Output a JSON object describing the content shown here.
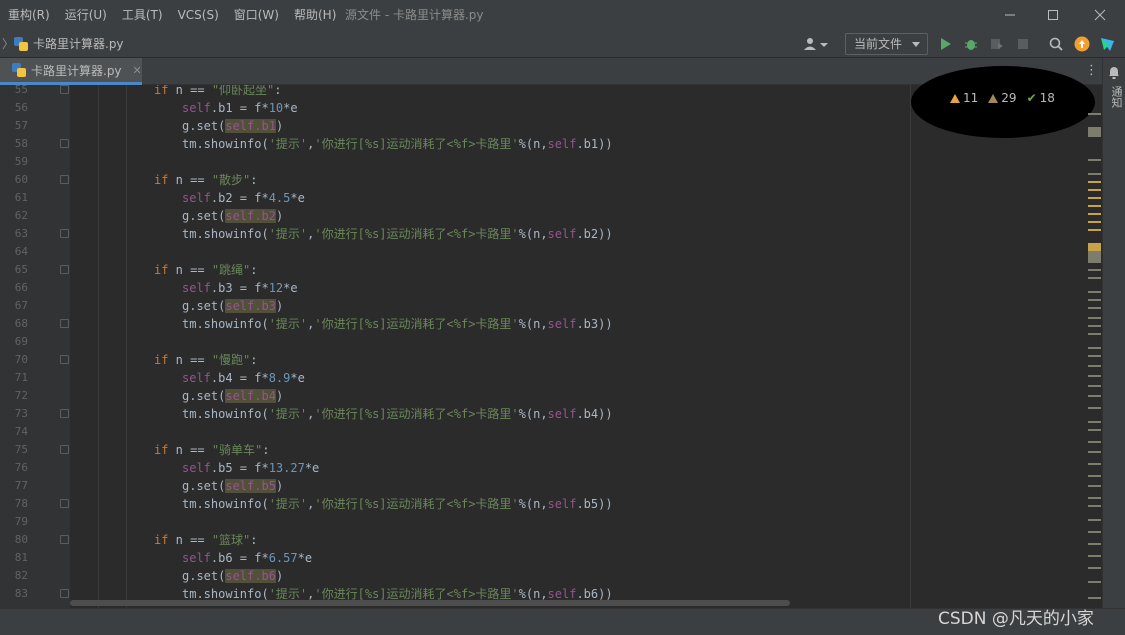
{
  "menu": [
    "重构(R)",
    "运行(U)",
    "工具(T)",
    "VCS(S)",
    "窗口(W)",
    "帮助(H)"
  ],
  "window_title": "源文件 - 卡路里计算器.py",
  "nav": {
    "file": "卡路里计算器.py"
  },
  "toolbar": {
    "run_config": "当前文件"
  },
  "tab": {
    "label": "卡路里计算器.py",
    "close": "✕"
  },
  "notifications_label": "通知",
  "inspections": {
    "warnings": "11",
    "weak_warnings": "29",
    "typos": "18"
  },
  "watermark": "CSDN @凡天的小家",
  "code_lines": [
    {
      "n": "55",
      "t": "if",
      "s": "\"仰卧起坐\"",
      "kind": "if"
    },
    {
      "n": "56",
      "var": "b1",
      "rhs": "10",
      "kind": "assign"
    },
    {
      "n": "57",
      "var": "b1",
      "kind": "set"
    },
    {
      "n": "58",
      "var": "b1",
      "kind": "show"
    },
    {
      "n": "59",
      "kind": "blank"
    },
    {
      "n": "60",
      "s": "\"散步\"",
      "kind": "if"
    },
    {
      "n": "61",
      "var": "b2",
      "rhs": "4.5",
      "kind": "assign"
    },
    {
      "n": "62",
      "var": "b2",
      "kind": "set"
    },
    {
      "n": "63",
      "var": "b2",
      "kind": "show"
    },
    {
      "n": "64",
      "kind": "blank"
    },
    {
      "n": "65",
      "s": "\"跳绳\"",
      "kind": "if"
    },
    {
      "n": "66",
      "var": "b3",
      "rhs": "12",
      "kind": "assign"
    },
    {
      "n": "67",
      "var": "b3",
      "kind": "set"
    },
    {
      "n": "68",
      "var": "b3",
      "kind": "show"
    },
    {
      "n": "69",
      "kind": "blank"
    },
    {
      "n": "70",
      "s": "\"慢跑\"",
      "kind": "if"
    },
    {
      "n": "71",
      "var": "b4",
      "rhs": "8.9",
      "kind": "assign"
    },
    {
      "n": "72",
      "var": "b4",
      "kind": "set"
    },
    {
      "n": "73",
      "var": "b4",
      "kind": "show"
    },
    {
      "n": "74",
      "kind": "blank"
    },
    {
      "n": "75",
      "s": "\"骑单车\"",
      "kind": "if"
    },
    {
      "n": "76",
      "var": "b5",
      "rhs": "13.27",
      "kind": "assign"
    },
    {
      "n": "77",
      "var": "b5",
      "kind": "set"
    },
    {
      "n": "78",
      "var": "b5",
      "kind": "show"
    },
    {
      "n": "79",
      "kind": "blank"
    },
    {
      "n": "80",
      "s": "\"篮球\"",
      "kind": "if"
    },
    {
      "n": "81",
      "var": "b6",
      "rhs": "6.57",
      "kind": "assign"
    },
    {
      "n": "82",
      "var": "b6",
      "kind": "set"
    },
    {
      "n": "83",
      "var": "b6",
      "kind": "show"
    }
  ],
  "code_text": {
    "if_kw": "if",
    "n_eq": " n == ",
    "colon": ":",
    "self": "self",
    "assign_mid": " = f*",
    "assign_end": "*e",
    "gset": "g.set(",
    "close": ")",
    "show_start": "tm.showinfo(",
    "show_title": "'提示'",
    "comma": ",",
    "show_msg": "'你进行[%s]运动消耗了<%f>卡路里'",
    "pct": "%",
    "show_args": "(n,",
    "show_end": "))"
  }
}
